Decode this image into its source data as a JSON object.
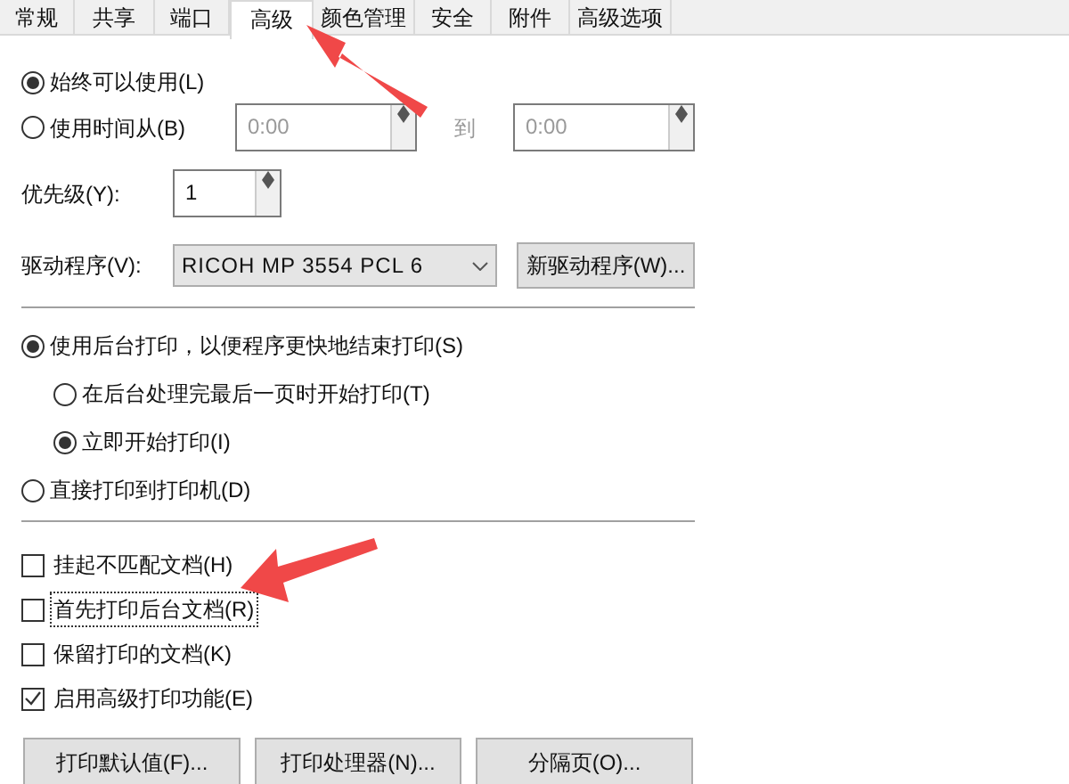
{
  "tabs": [
    {
      "label": "常规",
      "selected": false
    },
    {
      "label": "共享",
      "selected": false
    },
    {
      "label": "端口",
      "selected": false
    },
    {
      "label": "高级",
      "selected": true
    },
    {
      "label": "颜色管理",
      "selected": false
    },
    {
      "label": "安全",
      "selected": false
    },
    {
      "label": "附件",
      "selected": false
    },
    {
      "label": "高级选项",
      "selected": false
    }
  ],
  "availability": [
    {
      "label": "始终可以使用(L)",
      "selected": true
    },
    {
      "label": "使用时间从(B)",
      "selected": false
    }
  ],
  "time_from": {
    "value": "0:00",
    "disabled": true
  },
  "time_to_label": "到",
  "time_to": {
    "value": "0:00",
    "disabled": true
  },
  "priority": {
    "label": "优先级(Y):",
    "value": "1"
  },
  "driver": {
    "label": "驱动程序(V):",
    "value": "RICOH MP 3554 PCL 6",
    "button": "新驱动程序(W)..."
  },
  "spool_options": [
    {
      "label": "使用后台打印，以便程序更快地结束打印(S)",
      "selected": true,
      "children": [
        {
          "label": "在后台处理完最后一页时开始打印(T)",
          "selected": false
        },
        {
          "label": "立即开始打印(I)",
          "selected": true
        }
      ]
    },
    {
      "label": "直接打印到打印机(D)",
      "selected": false
    }
  ],
  "checkboxes": [
    {
      "label": "挂起不匹配文档(H)",
      "checked": false,
      "focused": false
    },
    {
      "label": "首先打印后台文档(R)",
      "checked": false,
      "focused": true
    },
    {
      "label": "保留打印的文档(K)",
      "checked": false,
      "focused": false
    },
    {
      "label": "启用高级打印功能(E)",
      "checked": true,
      "focused": false
    }
  ],
  "buttons": [
    "打印默认值(F)...",
    "打印处理器(N)...",
    "分隔页(O)..."
  ]
}
